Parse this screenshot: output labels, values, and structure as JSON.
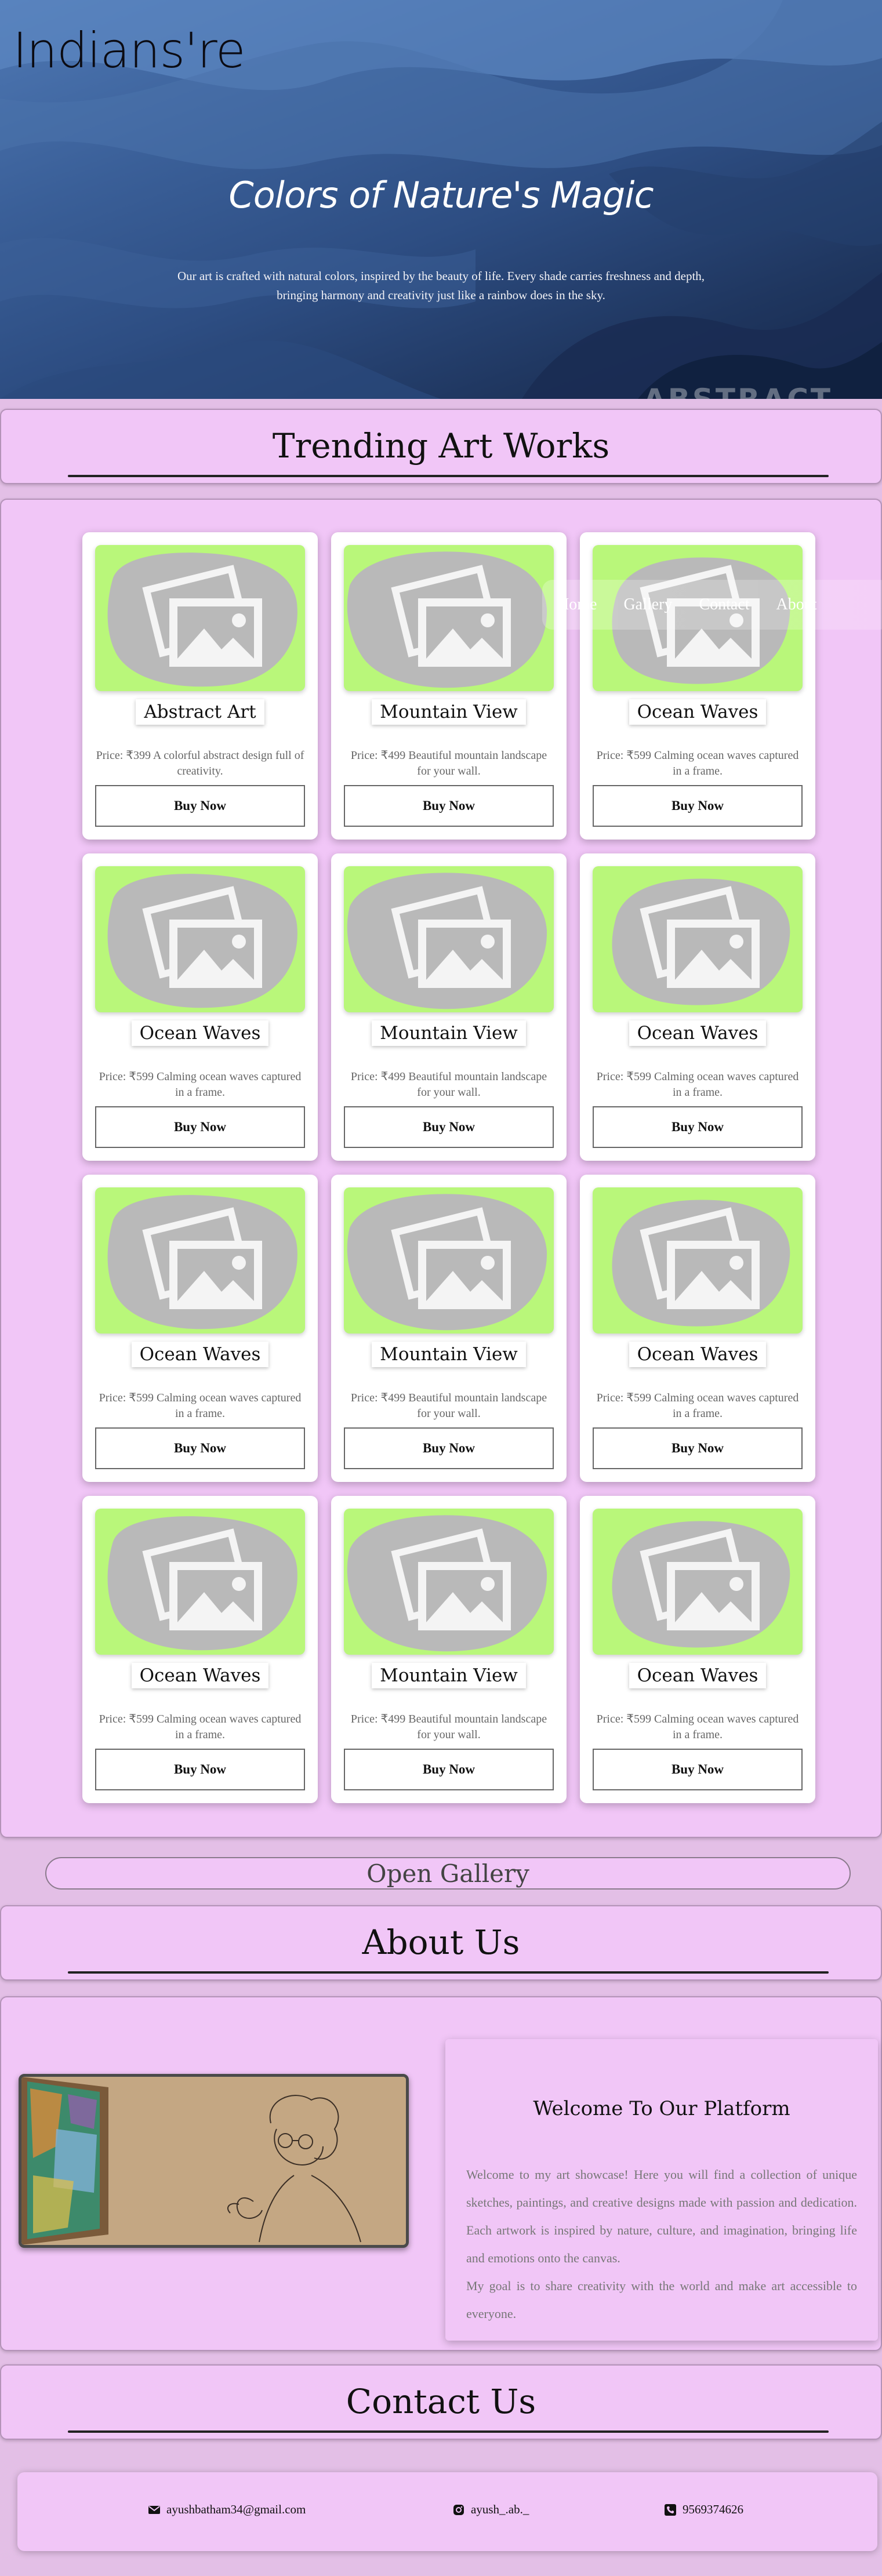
{
  "brand": {
    "logo": "Indians're"
  },
  "hero": {
    "title": "Colors of Nature's Magic",
    "text": "Our art is crafted with natural colors, inspired by the beauty of life. Every shade carries freshness and depth, bringing harmony and creativity just like a rainbow does in the sky.",
    "ghost_word": "ABSTRACT"
  },
  "nav": {
    "items": [
      "Home",
      "Gallery",
      "Contact",
      "About"
    ]
  },
  "trending": {
    "heading": "Trending Art Works",
    "cards": [
      {
        "name": "Abstract Art",
        "desc": "Price: ₹399 A colorful abstract design full of creativity.",
        "button": "Buy Now"
      },
      {
        "name": "Mountain View",
        "desc": "Price: ₹499 Beautiful mountain landscape for your wall.",
        "button": "Buy Now"
      },
      {
        "name": "Ocean Waves",
        "desc": "Price: ₹599 Calming ocean waves captured in a frame.",
        "button": "Buy Now"
      },
      {
        "name": "Ocean Waves",
        "desc": "Price: ₹599 Calming ocean waves captured in a frame.",
        "button": "Buy Now"
      },
      {
        "name": "Mountain View",
        "desc": "Price: ₹499 Beautiful mountain landscape for your wall.",
        "button": "Buy Now"
      },
      {
        "name": "Ocean Waves",
        "desc": "Price: ₹599 Calming ocean waves captured in a frame.",
        "button": "Buy Now"
      },
      {
        "name": "Ocean Waves",
        "desc": "Price: ₹599 Calming ocean waves captured in a frame.",
        "button": "Buy Now"
      },
      {
        "name": "Mountain View",
        "desc": "Price: ₹499 Beautiful mountain landscape for your wall.",
        "button": "Buy Now"
      },
      {
        "name": "Ocean Waves",
        "desc": "Price: ₹599 Calming ocean waves captured in a frame.",
        "button": "Buy Now"
      },
      {
        "name": "Ocean Waves",
        "desc": "Price: ₹599 Calming ocean waves captured in a frame.",
        "button": "Buy Now"
      },
      {
        "name": "Mountain View",
        "desc": "Price: ₹499 Beautiful mountain landscape for your wall.",
        "button": "Buy Now"
      },
      {
        "name": "Ocean Waves",
        "desc": "Price: ₹599 Calming ocean waves captured in a frame.",
        "button": "Buy Now"
      }
    ],
    "open_gallery": "Open Gallery"
  },
  "about": {
    "heading": "About Us",
    "card_title": "Welcome To Our Platform",
    "paragraph": "Welcome to my art showcase! Here you will find a collection of unique sketches, paintings, and creative designs made with passion and dedication. Each artwork is inspired by nature, culture, and imagination, bringing life and emotions onto the canvas.",
    "paragraph2": "My goal is to share creativity with the world and make art accessible to everyone."
  },
  "contact": {
    "heading": "Contact Us",
    "email": "ayushbatham34@gmail.com",
    "instagram": "ayush_.ab._",
    "phone": "9569374626",
    "icons": [
      "envelope-icon",
      "instagram-icon",
      "phone-icon"
    ]
  },
  "colors": {
    "page_bg": "#e3bfe6",
    "panel_bg": "#f1c6f7",
    "thumb_bg": "#b9f77a",
    "hero_blue": "#3a5f98"
  }
}
